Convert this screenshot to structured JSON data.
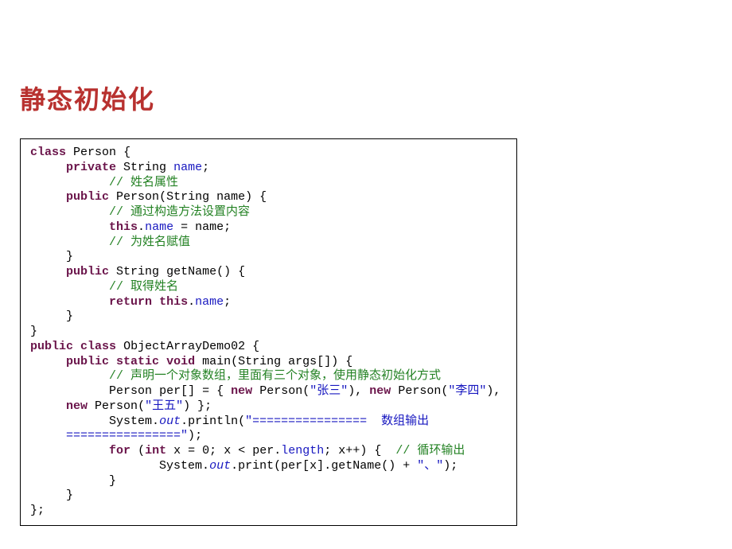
{
  "title": "静态初始化",
  "code": {
    "kw_class": "class",
    "kw_public": "public",
    "kw_private": "private",
    "kw_static": "static",
    "kw_void": "void",
    "kw_this": "this",
    "kw_return": "return",
    "kw_new": "new",
    "kw_for": "for",
    "kw_int": "int",
    "id_person": "Person",
    "id_string": "String",
    "id_name": "name",
    "id_getname": "getName",
    "id_objarr": "ObjectArrayDemo02",
    "id_main": "main",
    "id_args": "args",
    "id_per": "per",
    "id_system": "System",
    "id_out": "out",
    "id_println": "println",
    "id_print": "print",
    "id_x": "x",
    "id_length": "length",
    "cm_name_attr": "// 姓名属性",
    "cm_ctor": "// 通过构造方法设置内容",
    "cm_assign": "// 为姓名赋值",
    "cm_getname": "// 取得姓名",
    "cm_decl": "// 声明一个对象数组，里面有三个对象，使用静态初始化方式",
    "cm_loop": "// 循环输出",
    "str_zhangsan": "\"张三\"",
    "str_lisi": "\"李四\"",
    "str_wangwu": "\"王五\"",
    "str_output_head": "\"================  数组输出",
    "str_output_tail": "================\"",
    "str_sep": "\"、\"",
    "op_eq": " = ",
    "op_semi": ";",
    "op_comma": ",",
    "op_lbrace": "{",
    "op_rbrace": "}",
    "op_lparen": "(",
    "op_rparen": ")",
    "op_lbracket": "[",
    "op_rbracket": "]",
    "op_dot": ".",
    "op_lt": " < ",
    "op_inc": "++",
    "op_plus": " + ",
    "op_zero": "0"
  }
}
